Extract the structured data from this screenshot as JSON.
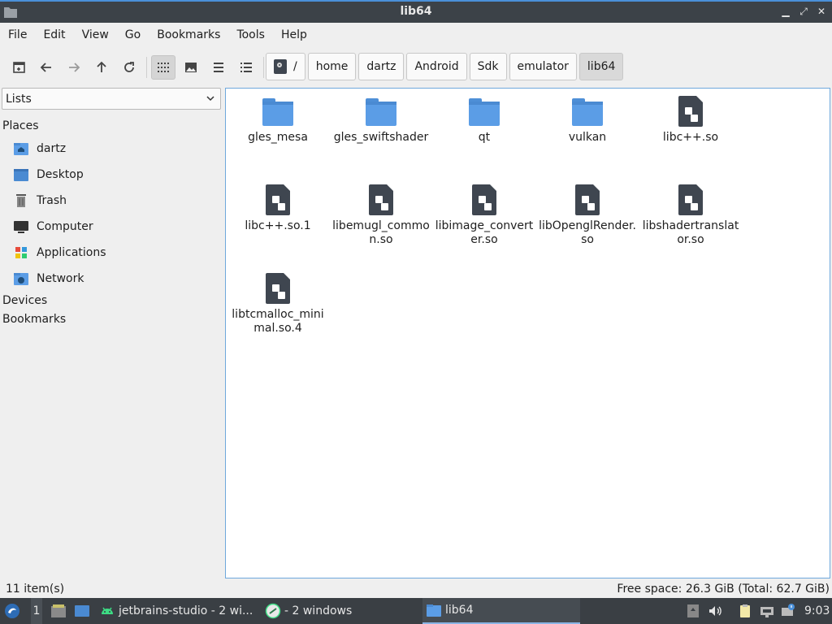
{
  "window": {
    "title": "lib64"
  },
  "menu": [
    "File",
    "Edit",
    "View",
    "Go",
    "Bookmarks",
    "Tools",
    "Help"
  ],
  "pathbar": {
    "root": "/",
    "crumbs": [
      "home",
      "dartz",
      "Android",
      "Sdk",
      "emulator",
      "lib64"
    ]
  },
  "sidebar": {
    "selector": "Lists",
    "places_header": "Places",
    "places": [
      "dartz",
      "Desktop",
      "Trash",
      "Computer",
      "Applications",
      "Network"
    ],
    "devices_header": "Devices",
    "bookmarks_header": "Bookmarks"
  },
  "files": [
    {
      "name": "gles_mesa",
      "type": "folder"
    },
    {
      "name": "gles_swiftshader",
      "type": "folder"
    },
    {
      "name": "qt",
      "type": "folder"
    },
    {
      "name": "vulkan",
      "type": "folder"
    },
    {
      "name": "libc++.so",
      "type": "library"
    },
    {
      "name": "libc++.so.1",
      "type": "library"
    },
    {
      "name": "libemugl_common.so",
      "type": "library"
    },
    {
      "name": "libimage_converter.so",
      "type": "library"
    },
    {
      "name": "libOpenglRender.so",
      "type": "library"
    },
    {
      "name": "libshadertranslator.so",
      "type": "library"
    },
    {
      "name": "libtcmalloc_minimal.so.4",
      "type": "library"
    }
  ],
  "status": {
    "items": "11 item(s)",
    "free_space": "Free space: 26.3 GiB (Total: 62.7 GiB)"
  },
  "taskbar": {
    "workspace": "1",
    "tasks": [
      "jetbrains-studio - 2 wi...",
      "- 2 windows",
      "lib64"
    ],
    "clock": "9:03"
  },
  "colors": {
    "accent": "#4a90d9",
    "folder": "#5b9de6",
    "file": "#3f4650",
    "panel": "#3a3f44"
  }
}
